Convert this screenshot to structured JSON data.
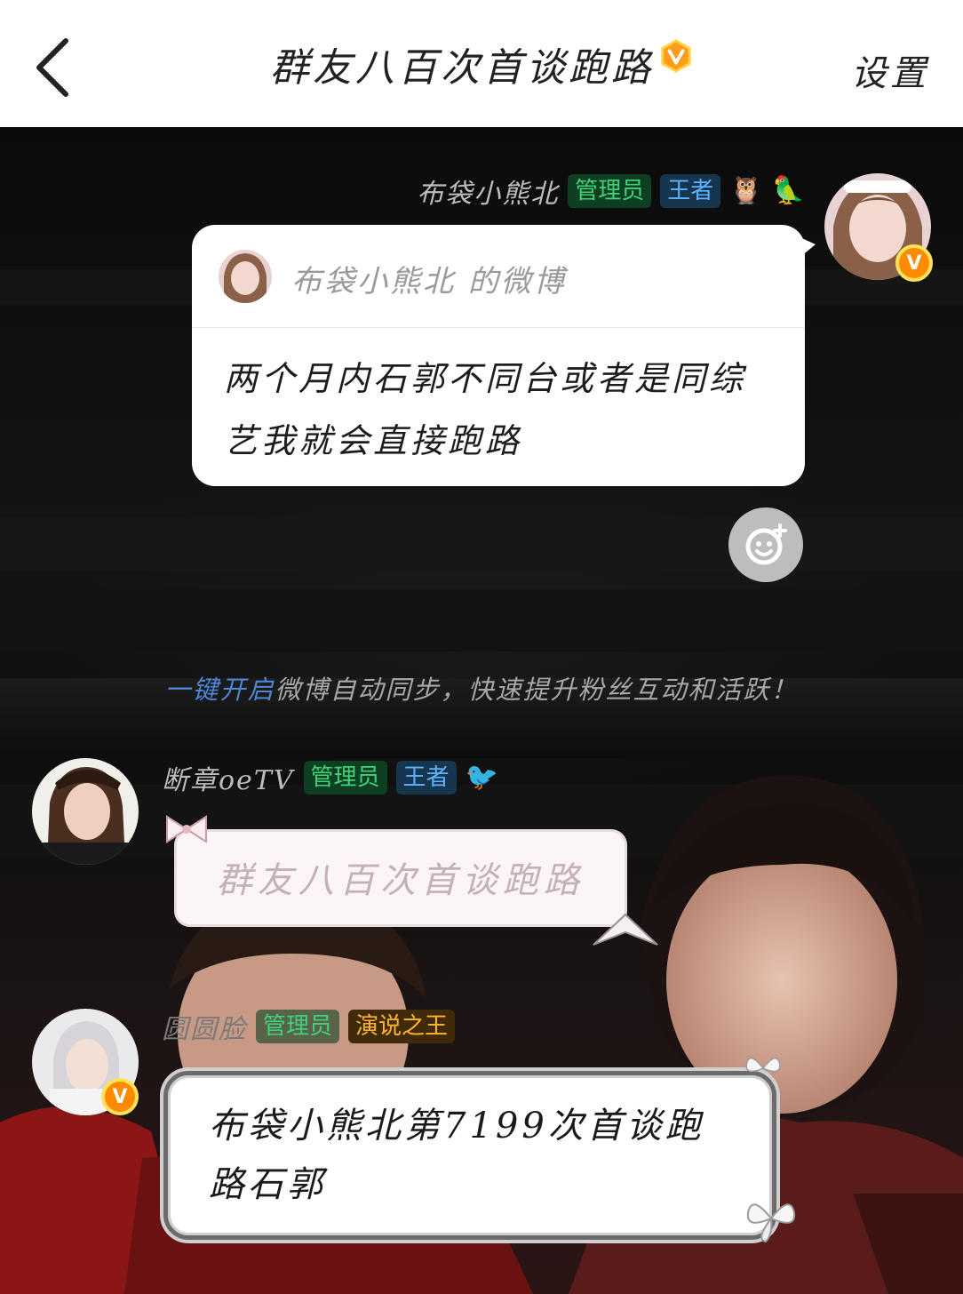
{
  "header": {
    "title": "群友八百次首谈跑路",
    "settings_label": "设置",
    "back_icon": "chevron-left-icon",
    "vip_icon": "orange-v-badge-icon"
  },
  "messages": [
    {
      "sender": "布袋小熊北",
      "tags": [
        "管理员",
        "王者"
      ],
      "badges": [
        "owl-emoji",
        "bird-emoji"
      ],
      "verified": true,
      "card": {
        "source": "布袋小熊北 的微博",
        "body": "两个月内石郭不同台或者是同综艺我就会直接跑路"
      }
    },
    {
      "sender": "断章oeTV",
      "tags": [
        "管理员",
        "王者"
      ],
      "badges": [
        "bird-emoji"
      ],
      "text": "群友八百次首谈跑路"
    },
    {
      "sender": "圆圆脸",
      "tags": [
        "管理员",
        "演说之王"
      ],
      "verified": true,
      "text": "布袋小熊北第7199次首谈跑路石郭"
    }
  ],
  "sync_tip": {
    "link": "一键开启",
    "text": "微博自动同步，快速提升粉丝互动和活跃！"
  },
  "badge_letter": "V",
  "colors": {
    "admin_tag": "#3fd27a",
    "king_tag": "#5fb3ff",
    "speech_tag": "#ffb52e",
    "link": "#4e86d6",
    "vip": "#ff8a00"
  }
}
